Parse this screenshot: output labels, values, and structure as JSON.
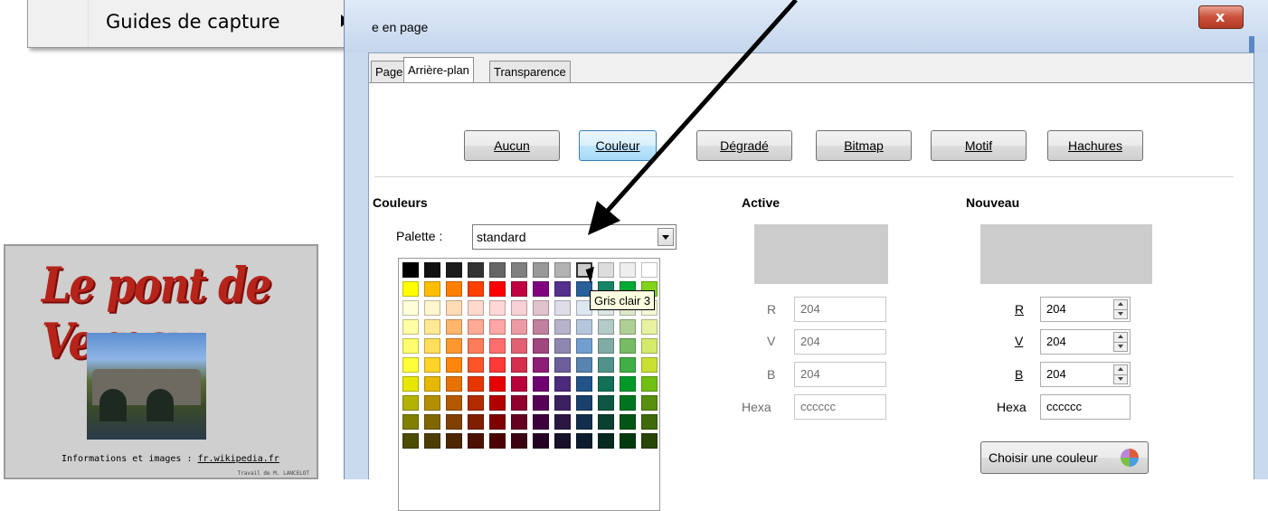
{
  "context_menu": {
    "item_label": "Guides de capture"
  },
  "slide": {
    "title": "Le pont de Vernay",
    "info_text": "Informations et images : ",
    "info_link": "fr.wikipedia.fr",
    "credit": "Travail de M. LANCELOT"
  },
  "dialog": {
    "title": "e en page",
    "close_label": "x",
    "tabs": [
      "Page",
      "Arrière-plan",
      "Transparence"
    ],
    "type_buttons": {
      "none": "Aucun",
      "color": "Couleur",
      "gradient": "Dégradé",
      "bitmap": "Bitmap",
      "pattern": "Motif",
      "hatching": "Hachures"
    },
    "colors_section": {
      "heading": "Couleurs",
      "palette_label": "Palette :",
      "palette_value": "standard",
      "tooltip": "Gris clair 3"
    },
    "active_section": {
      "heading": "Active",
      "r_label": "R",
      "r_value": "204",
      "g_label": "V",
      "g_value": "204",
      "b_label": "B",
      "b_value": "204",
      "hex_label": "Hexa",
      "hex_value": "cccccc",
      "preview_color": "#cccccc"
    },
    "new_section": {
      "heading": "Nouveau",
      "r_label": "R",
      "r_value": "204",
      "g_label": "V",
      "g_value": "204",
      "b_label": "B",
      "b_value": "204",
      "hex_label": "Hexa",
      "hex_value": "cccccc",
      "preview_color": "#cccccc",
      "pick_button": "Choisir une couleur"
    }
  },
  "palette_rows": [
    [
      "#000000",
      "#111111",
      "#1c1c1c",
      "#333333",
      "#666666",
      "#808080",
      "#999999",
      "#b2b2b2",
      "#cccccc",
      "#dddddd",
      "#eeeeee",
      "#ffffff"
    ],
    [
      "#ffff00",
      "#ffbf00",
      "#ff8000",
      "#ff4000",
      "#ff0000",
      "#bf0041",
      "#800080",
      "#55308d",
      "#2a6099",
      "#158466",
      "#00a933",
      "#81d41a"
    ],
    [
      "#ffffd7",
      "#fff5ce",
      "#ffdbb6",
      "#ffd8ce",
      "#ffd7d7",
      "#f7d1d5",
      "#e0c2cd",
      "#dedce6",
      "#dee6ef",
      "#dee7e5",
      "#dde8cb",
      "#f6f9d4"
    ],
    [
      "#ffffa6",
      "#ffe994",
      "#ffb66c",
      "#ffaa95",
      "#ffa6a6",
      "#ec9ba4",
      "#bf819e",
      "#b7b3ca",
      "#b4c7dc",
      "#b3cac7",
      "#afd095",
      "#e8f2a1"
    ],
    [
      "#ffff6d",
      "#ffde59",
      "#ff972f",
      "#ff7b59",
      "#ff6d6d",
      "#e16173",
      "#a1467e",
      "#8e86ae",
      "#729fcf",
      "#81aca6",
      "#77bc65",
      "#d4ea6b"
    ],
    [
      "#ffff38",
      "#ffd428",
      "#ff860d",
      "#ff5429",
      "#ff3838",
      "#d62e4e",
      "#8d1d75",
      "#6b5e9b",
      "#5983b0",
      "#50938a",
      "#3faf46",
      "#c9e033"
    ],
    [
      "#e6e600",
      "#e6b800",
      "#e67300",
      "#e63600",
      "#e60000",
      "#b8003a",
      "#700070",
      "#4c2a7c",
      "#22548a",
      "#127056",
      "#009928",
      "#72bf14"
    ],
    [
      "#b2b200",
      "#b28f00",
      "#b25900",
      "#b22a00",
      "#b20000",
      "#8f002d",
      "#560056",
      "#3b2160",
      "#19416b",
      "#0e5743",
      "#00751f",
      "#578f0f"
    ],
    [
      "#807f00",
      "#7f6600",
      "#804000",
      "#801f00",
      "#800000",
      "#660020",
      "#3d003d",
      "#2a1843",
      "#122e4c",
      "#0a4030",
      "#005615",
      "#3f6a0b"
    ],
    [
      "#4d4d00",
      "#4d3d00",
      "#4d2600",
      "#4d1300",
      "#4d0000",
      "#3d0013",
      "#250025",
      "#19102a",
      "#0b1c2e",
      "#062a1f",
      "#003a0e",
      "#284508"
    ]
  ]
}
